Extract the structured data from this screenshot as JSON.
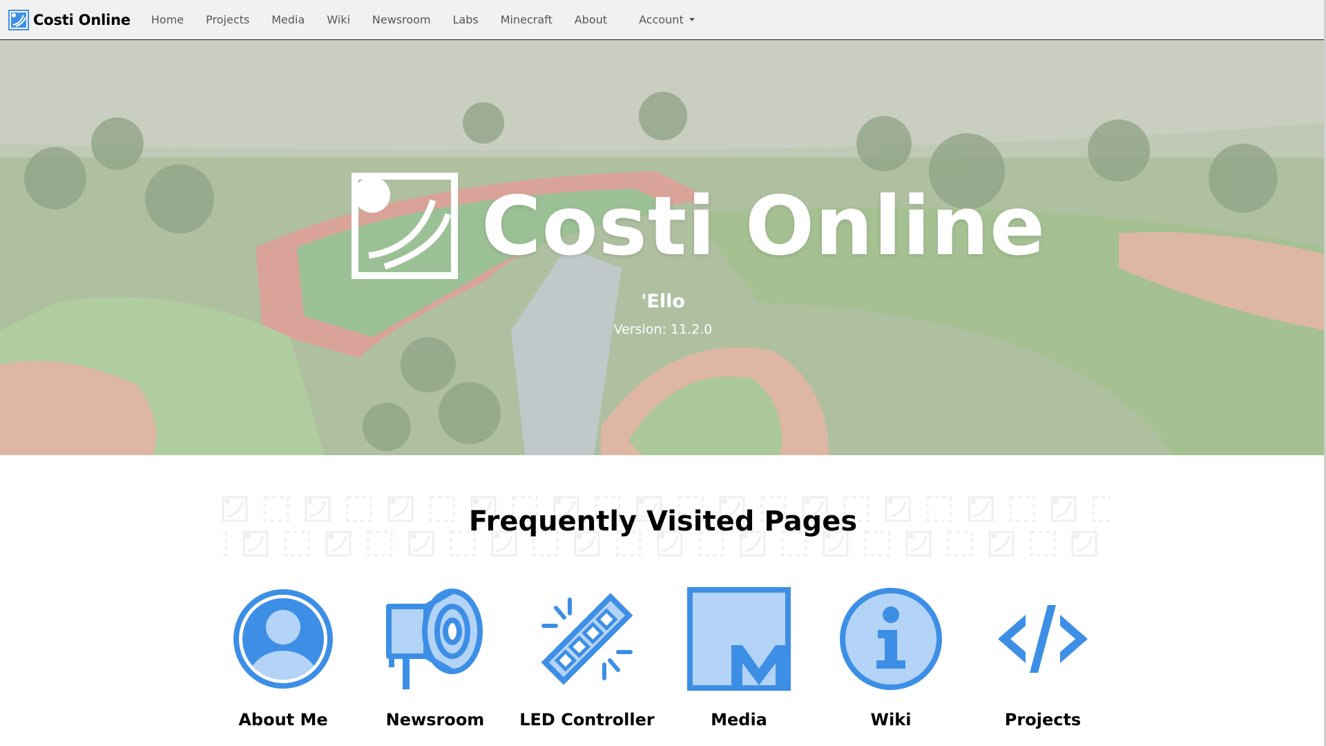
{
  "navbar": {
    "brand": "Costi Online",
    "links": [
      "Home",
      "Projects",
      "Media",
      "Wiki",
      "Newsroom",
      "Labs",
      "Minecraft",
      "About"
    ],
    "account_label": "Account"
  },
  "hero": {
    "title": "Costi Online",
    "subtitle": "'Ello",
    "version": "Version: 11.2.0"
  },
  "section": {
    "title": "Frequently Visited Pages",
    "cards": [
      {
        "label": "About Me",
        "icon": "user-icon"
      },
      {
        "label": "Newsroom",
        "icon": "megaphone-icon"
      },
      {
        "label": "LED Controller",
        "icon": "led-strip-icon"
      },
      {
        "label": "Media",
        "icon": "media-icon"
      },
      {
        "label": "Wiki",
        "icon": "info-icon"
      },
      {
        "label": "Projects",
        "icon": "code-icon"
      }
    ]
  },
  "colors": {
    "accent": "#3d8fe6",
    "accent_light": "#b3d3f7",
    "navbar_bg": "#f1f1f1"
  }
}
